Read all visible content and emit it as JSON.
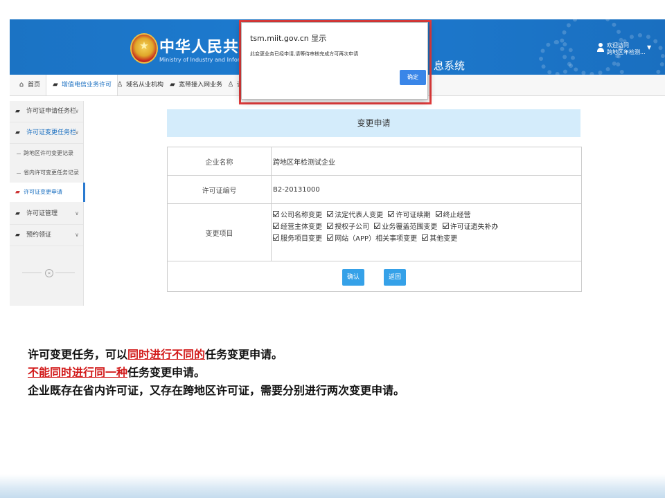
{
  "header": {
    "brand_cn": "中华人民共和国",
    "brand_en": "Ministry of Industry and Information Te",
    "system_tail": "息系统",
    "user_greeting": "欢迎访问",
    "user_name": "跨地区年检测..."
  },
  "topnav": [
    {
      "label": "首页",
      "icon": "home-icon"
    },
    {
      "label": "增值电信业务许可",
      "icon": "cup-icon",
      "active": true
    },
    {
      "label": "域名从业机构",
      "icon": "person-icon"
    },
    {
      "label": "宽带接入网业务",
      "icon": "cup-icon"
    },
    {
      "label": "诗",
      "icon": "person-icon"
    }
  ],
  "sidebar": {
    "items": [
      {
        "label": "许可证申请任务栏"
      },
      {
        "label": "许可证变更任务栏"
      },
      {
        "label": "跨地区许可变更记录"
      },
      {
        "label": "省内许可变更任务记录"
      },
      {
        "label": "许可证变更申请"
      },
      {
        "label": "许可证管理"
      },
      {
        "label": "预约领证"
      }
    ]
  },
  "form": {
    "title": "变更申请",
    "company_label": "企业名称",
    "company_value": "跨地区年检测试企业",
    "license_label": "许可证编号",
    "license_value": "B2-20131000",
    "items_label": "变更项目",
    "options": [
      "公司名称变更",
      "法定代表人变更",
      "许可证续期",
      "终止经营",
      "经营主体变更",
      "授权子公司",
      "业务覆盖范围变更",
      "许可证遗失补办",
      "服务项目变更",
      "网站（APP）相关事项变更",
      "其他变更"
    ],
    "confirm_label": "确认",
    "back_label": "返回"
  },
  "alert": {
    "host": "tsm.miit.gov.cn 显示",
    "message": "此变更业务已经申请,请等待审核完成方可再次申请",
    "ok_label": "确定"
  },
  "notes": {
    "line1_a": "许可变更任务，可以",
    "line1_red": "同时进行不同的",
    "line1_b": "任务变更申请。",
    "line2_red": "不能同时进行同一种",
    "line2_b": "任务变更申请。",
    "line3": "企业既存在省内许可证，又存在跨地区许可证，需要分别进行两次变更申请。"
  },
  "colors": {
    "banner_blue": "#1b73c4",
    "accent_blue": "#35a1e8",
    "alert_red": "#e53c3c",
    "note_red": "#d21a1a"
  }
}
